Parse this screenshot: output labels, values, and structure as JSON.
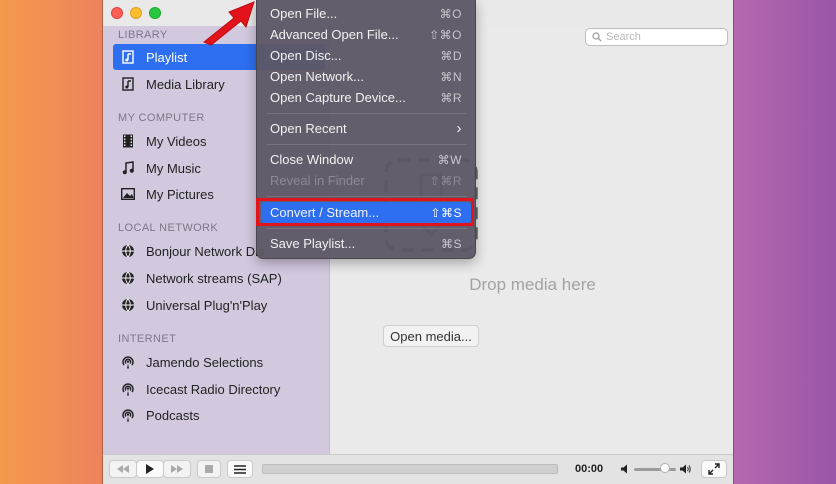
{
  "sidebar": {
    "sections": [
      {
        "header": "LIBRARY",
        "items": [
          {
            "label": "Playlist",
            "icon": "playlist-icon",
            "selected": true
          },
          {
            "label": "Media Library",
            "icon": "media-library-icon"
          }
        ]
      },
      {
        "header": "MY COMPUTER",
        "items": [
          {
            "label": "My Videos",
            "icon": "film-icon"
          },
          {
            "label": "My Music",
            "icon": "music-note-icon"
          },
          {
            "label": "My Pictures",
            "icon": "picture-icon"
          }
        ]
      },
      {
        "header": "LOCAL NETWORK",
        "items": [
          {
            "label": "Bonjour Network Dis",
            "icon": "globe-icon"
          },
          {
            "label": "Network streams (SAP)",
            "icon": "globe-icon"
          },
          {
            "label": "Universal Plug'n'Play",
            "icon": "globe-icon"
          }
        ]
      },
      {
        "header": "INTERNET",
        "items": [
          {
            "label": "Jamendo Selections",
            "icon": "podcast-icon"
          },
          {
            "label": "Icecast Radio Directory",
            "icon": "podcast-icon"
          },
          {
            "label": "Podcasts",
            "icon": "podcast-icon"
          }
        ]
      }
    ]
  },
  "search": {
    "placeholder": "Search"
  },
  "content": {
    "drop_text": "Drop media here",
    "open_media_label": "Open media..."
  },
  "file_menu": {
    "items": [
      {
        "label": "Open File...",
        "shortcut": "⌘O"
      },
      {
        "label": "Advanced Open File...",
        "shortcut": "⇧⌘O"
      },
      {
        "label": "Open Disc...",
        "shortcut": "⌘D"
      },
      {
        "label": "Open Network...",
        "shortcut": "⌘N"
      },
      {
        "label": "Open Capture Device...",
        "shortcut": "⌘R"
      },
      {
        "label": "Open Recent",
        "shortcut": "›"
      },
      {
        "label": "Close Window",
        "shortcut": "⌘W"
      },
      {
        "label": "Reveal in Finder",
        "shortcut": "⇧⌘R",
        "disabled": true
      },
      {
        "label": "Convert / Stream...",
        "shortcut": "⇧⌘S",
        "highlighted": true
      },
      {
        "label": "Save Playlist...",
        "shortcut": "⌘S"
      }
    ]
  },
  "player": {
    "time": "00:00",
    "volume_fraction": 0.8,
    "progress_fraction": 0
  },
  "colors": {
    "selection": "#2d6ff0",
    "callout": "#e3131b"
  }
}
